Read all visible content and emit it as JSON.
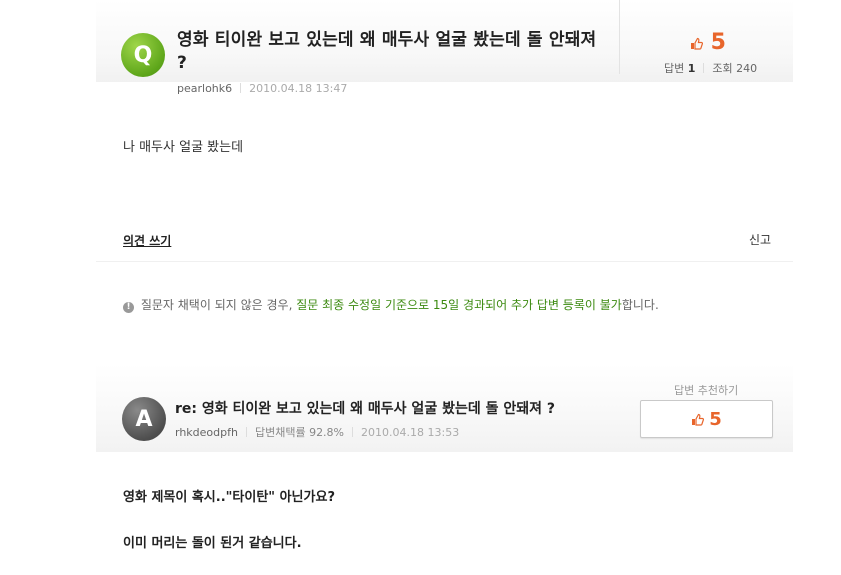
{
  "question": {
    "badge": "Q",
    "title": "영화 티이완 보고 있는데 왜 매두사 얼굴 봤는데 돌 안돼져 ?",
    "author": "pearlohk6",
    "date": "2010.04.18 13:47",
    "recommend_count": "5",
    "answers_label": "답변",
    "answers_count": "1",
    "views_label": "조회",
    "views_count": "240",
    "body": "나 매두사 얼굴 봤는데"
  },
  "actions": {
    "opinion_write": "의견 쓰기",
    "report": "신고"
  },
  "notice": {
    "prefix": "질문자 채택이 되지 않은 경우,",
    "highlight": "질문 최종 수정일 기준으로 15일 경과되어 추가 답변 등록이 불가",
    "suffix": "합니다."
  },
  "answer": {
    "badge": "A",
    "title": "re: 영화 티이완 보고 있는데 왜 매두사 얼굴 봤는데 돌 안돼져 ?",
    "author": "rhkdeodpfh",
    "adopt_rate": "답변채택률 92.8%",
    "date": "2010.04.18 13:53",
    "recommend_label": "답변 추천하기",
    "recommend_count": "5",
    "body_line1": "영화 제목이 혹시..\"타이탄\" 아닌가요?",
    "body_line2": "이미 머리는 돌이 된거 같습니다."
  },
  "colors": {
    "accent_orange": "#e8652b",
    "notice_green": "#3c8a10",
    "q_avatar": "#6cb21f",
    "a_avatar": "#555555"
  },
  "icons": [
    "thumbs-up-icon",
    "info-icon"
  ]
}
